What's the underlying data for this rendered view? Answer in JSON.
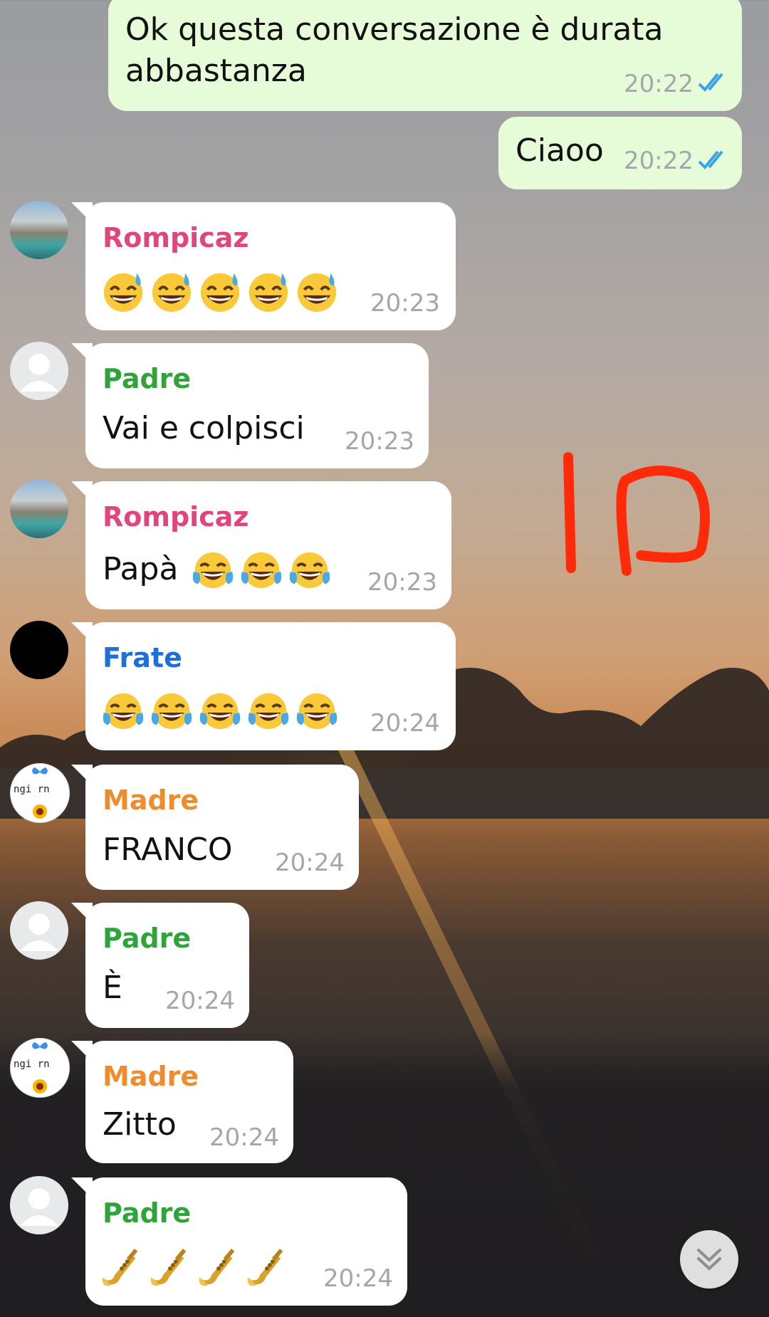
{
  "colors": {
    "outgoing_bubble": "#e6fbd8",
    "incoming_bubble": "#ffffff",
    "read_ticks": "#3aa3e6",
    "sender_rompicaz": "#e0457b",
    "sender_padre": "#2fa43a",
    "sender_frate": "#1f6fd8",
    "sender_madre": "#ef8c2e",
    "overlay_mark": "#ff2a0a"
  },
  "overlay_text": "10",
  "messages": [
    {
      "direction": "out",
      "text": "Ok questa conversazione è durata",
      "text2": "abbastanza",
      "time": "20:22",
      "status": "read"
    },
    {
      "direction": "out",
      "text": "Ciaoo",
      "time": "20:22",
      "status": "read"
    },
    {
      "direction": "in",
      "sender": "Rompicaz",
      "emoji": [
        "grinning-sweat-emoji",
        "grinning-sweat-emoji",
        "grinning-sweat-emoji",
        "grinning-sweat-emoji",
        "grinning-sweat-emoji"
      ],
      "time": "20:23"
    },
    {
      "direction": "in",
      "sender": "Padre",
      "text": "Vai e colpisci",
      "time": "20:23"
    },
    {
      "direction": "in",
      "sender": "Rompicaz",
      "text": "Papà",
      "emoji": [
        "tears-of-joy-emoji",
        "tears-of-joy-emoji",
        "tears-of-joy-emoji"
      ],
      "time": "20:23"
    },
    {
      "direction": "in",
      "sender": "Frate",
      "emoji": [
        "tears-of-joy-emoji",
        "tears-of-joy-emoji",
        "tears-of-joy-emoji",
        "tears-of-joy-emoji",
        "tears-of-joy-emoji"
      ],
      "time": "20:24"
    },
    {
      "direction": "in",
      "sender": "Madre",
      "text": "FRANCO",
      "time": "20:24"
    },
    {
      "direction": "in",
      "sender": "Padre",
      "text": "È",
      "time": "20:24"
    },
    {
      "direction": "in",
      "sender": "Madre",
      "text": "Zitto",
      "time": "20:24"
    },
    {
      "direction": "in",
      "sender": "Padre",
      "emoji": [
        "trumpet-emoji",
        "trumpet-emoji",
        "trumpet-emoji",
        "trumpet-emoji"
      ],
      "time": "20:24"
    }
  ],
  "madre_avatar_text": "ngi rn"
}
